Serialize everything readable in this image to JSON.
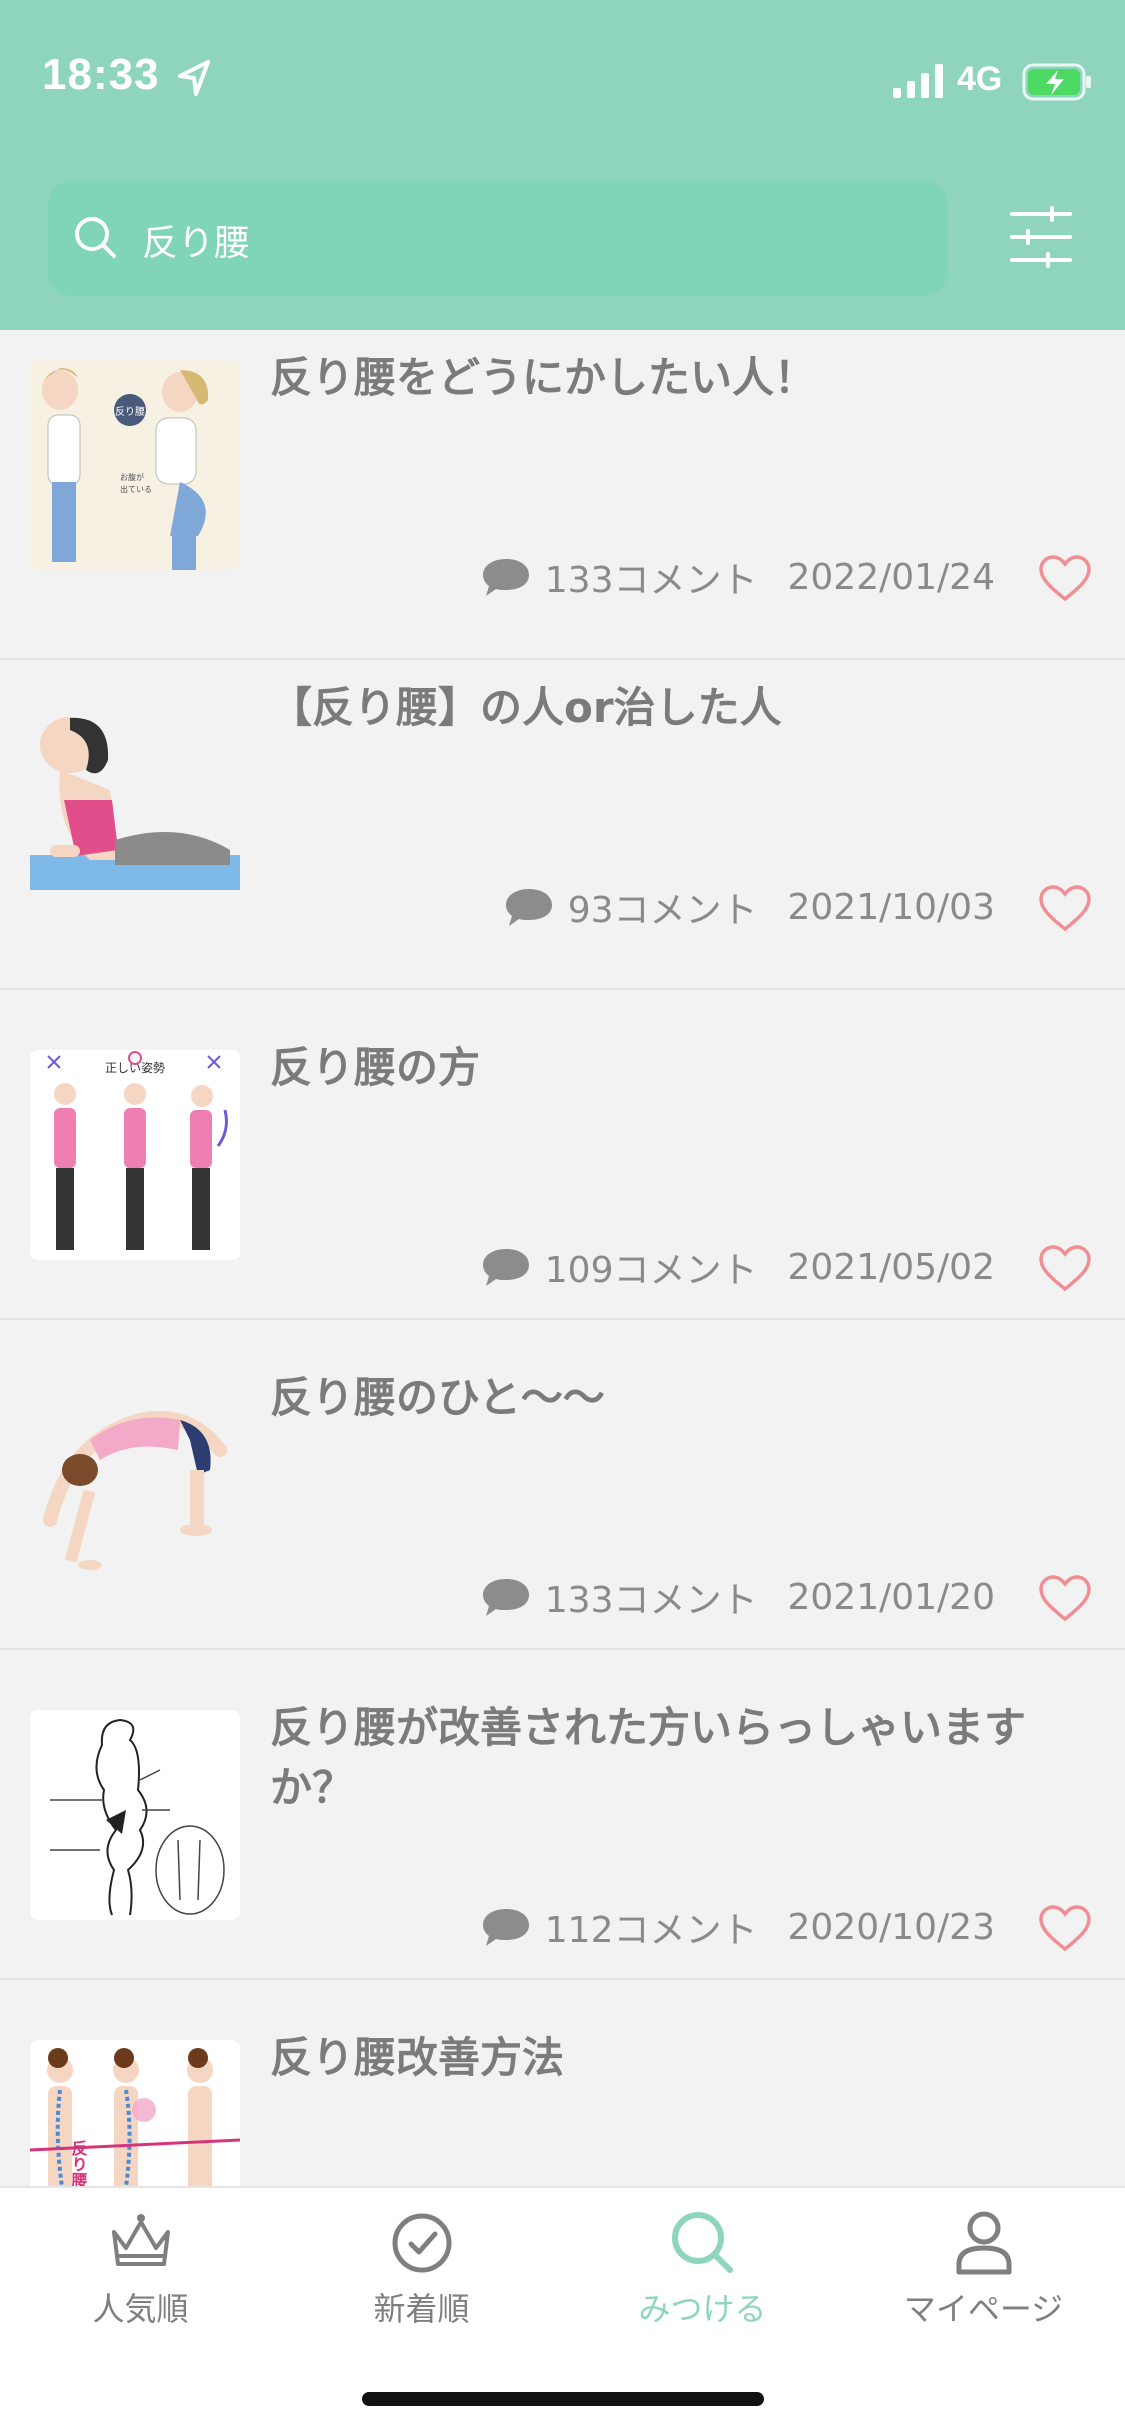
{
  "status_bar": {
    "time": "18:33",
    "network": "4G"
  },
  "search": {
    "query": "反り腰"
  },
  "colors": {
    "accent": "#8fd5bd",
    "heart": "#f08e94"
  },
  "posts": [
    {
      "title": "反り腰をどうにかしたい人！",
      "comments": "133コメント",
      "date": "2022/01/24",
      "thumb_label": "反り腰"
    },
    {
      "title": "【反り腰】の人or治した人",
      "comments": "93コメント",
      "date": "2021/10/03"
    },
    {
      "title": "反り腰の方",
      "comments": "109コメント",
      "date": "2021/05/02",
      "thumb_label": "正しい姿勢"
    },
    {
      "title": "反り腰のひと〜〜",
      "comments": "133コメント",
      "date": "2021/01/20"
    },
    {
      "title": "反り腰が改善された方いらっしゃいますか？",
      "comments": "112コメント",
      "date": "2020/10/23"
    },
    {
      "title": "反り腰改善方法",
      "comments": "",
      "date": "",
      "thumb_label": "反り腰タイプ"
    }
  ],
  "tabs": [
    {
      "label": "人気順",
      "icon": "crown-icon"
    },
    {
      "label": "新着順",
      "icon": "clock-icon"
    },
    {
      "label": "みつける",
      "icon": "search-icon",
      "active": true
    },
    {
      "label": "マイページ",
      "icon": "person-icon"
    }
  ]
}
